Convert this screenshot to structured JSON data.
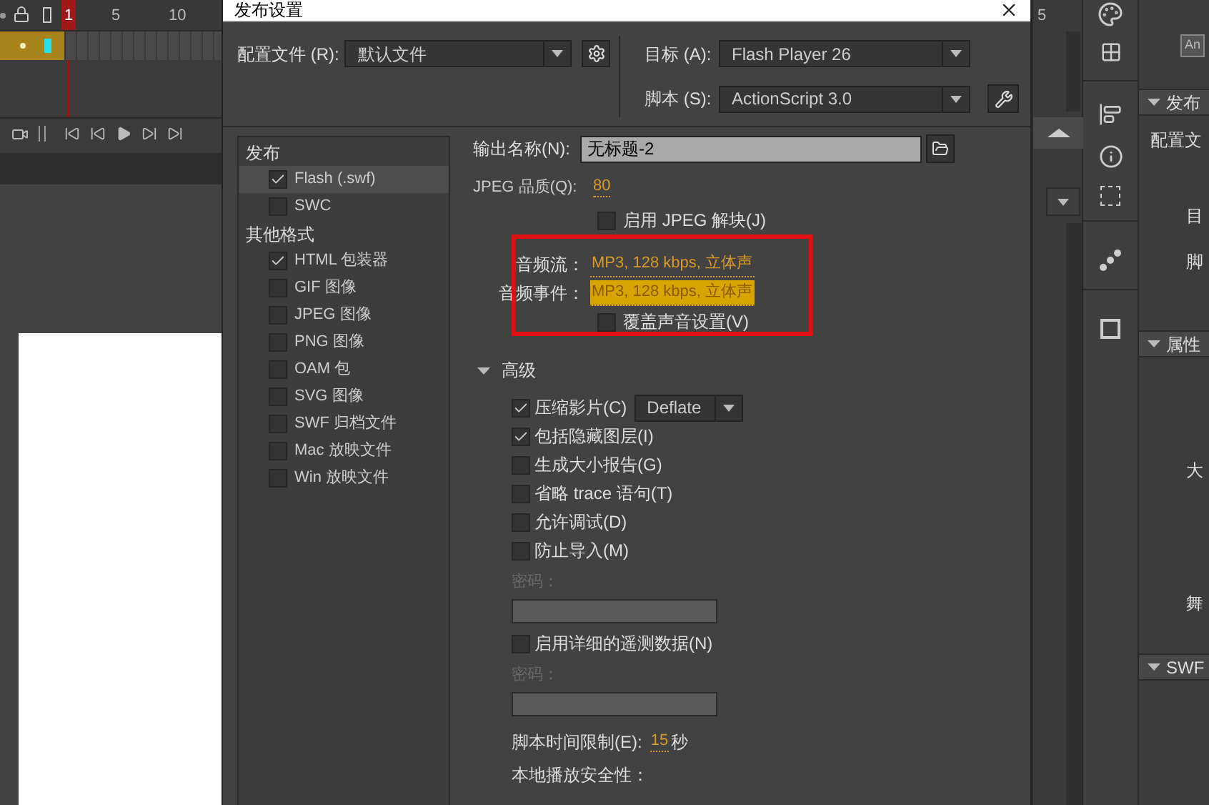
{
  "timeline": {
    "frame_numbers": [
      "1",
      "5",
      "10"
    ]
  },
  "right_ruler": "5",
  "dialog": {
    "title": "发布设置",
    "profile": {
      "label": "配置文件 (R):",
      "value": "默认文件"
    },
    "target": {
      "label": "目标 (A):",
      "value": "Flash Player 26"
    },
    "script": {
      "label": "脚本 (S):",
      "value": "ActionScript 3.0"
    },
    "formats": [
      {
        "header": "发布",
        "items": [
          {
            "label": "Flash (.swf)",
            "checked": true,
            "selected": true
          },
          {
            "label": "SWC",
            "checked": false,
            "selected": false
          }
        ]
      },
      {
        "header": "其他格式",
        "items": [
          {
            "label": "HTML 包装器",
            "checked": true,
            "selected": false
          },
          {
            "label": "GIF 图像",
            "checked": false,
            "selected": false
          },
          {
            "label": "JPEG 图像",
            "checked": false,
            "selected": false
          },
          {
            "label": "PNG 图像",
            "checked": false,
            "selected": false
          },
          {
            "label": "OAM 包",
            "checked": false,
            "selected": false
          },
          {
            "label": "SVG 图像",
            "checked": false,
            "selected": false
          },
          {
            "label": "SWF 归档文件",
            "checked": false,
            "selected": false
          },
          {
            "label": "Mac 放映文件",
            "checked": false,
            "selected": false
          },
          {
            "label": "Win 放映文件",
            "checked": false,
            "selected": false
          }
        ]
      }
    ],
    "output_name": {
      "label": "输出名称(N):",
      "value": "无标题-2"
    },
    "jpeg_quality": {
      "label": "JPEG 品质(Q):",
      "value": "80"
    },
    "jpeg_deblock": {
      "label": "启用 JPEG 解块(J)",
      "checked": false
    },
    "audio": [
      {
        "label": "音频流：",
        "value": "MP3, 128 kbps, 立体声",
        "selected": false
      },
      {
        "label": "音频事件：",
        "value": "MP3, 128 kbps, 立体声",
        "selected": true
      }
    ],
    "override_sound": {
      "label": "覆盖声音设置(V)",
      "checked": false
    },
    "advanced": {
      "label": "高级",
      "expanded": true,
      "options": [
        {
          "kind": "checkbox",
          "label": "压缩影片(C)",
          "checked": true,
          "dropdown": "Deflate"
        },
        {
          "kind": "checkbox",
          "label": "包括隐藏图层(I)",
          "checked": true
        },
        {
          "kind": "checkbox",
          "label": "生成大小报告(G)",
          "checked": false
        },
        {
          "kind": "checkbox",
          "label": "省略 trace 语句(T)",
          "checked": false
        },
        {
          "kind": "checkbox",
          "label": "允许调试(D)",
          "checked": false
        },
        {
          "kind": "checkbox",
          "label": "防止导入(M)",
          "checked": false
        },
        {
          "kind": "password",
          "label": "密码：",
          "disabled": true
        },
        {
          "kind": "checkbox",
          "label": "启用详细的遥测数据(N)",
          "checked": false
        },
        {
          "kind": "password",
          "label": "密码：",
          "disabled": true
        }
      ]
    },
    "script_time_limit": {
      "label": "脚本时间限制(E):",
      "value": "15",
      "unit": "秒"
    },
    "local_playback": {
      "label": "本地播放安全性："
    }
  },
  "side_panel": {
    "badge": "An",
    "sections": [
      {
        "title": "发布",
        "expanded": true,
        "labels": [
          "配置文",
          "目",
          "脚"
        ]
      },
      {
        "title": "属性",
        "expanded": true,
        "labels": [
          "大",
          "舞"
        ]
      },
      {
        "title": "SWF",
        "expanded": true
      }
    ]
  }
}
